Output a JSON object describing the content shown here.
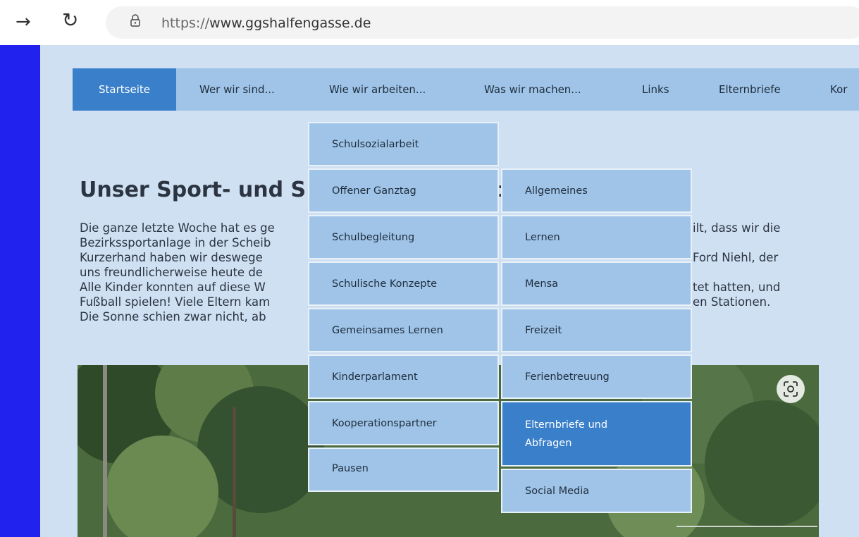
{
  "browser": {
    "url_prefix": "https://",
    "url_host": "www.ggshalfengasse.de",
    "forward_icon": "arrow-right-icon",
    "reload_icon": "reload-icon",
    "lock_icon": "lock-icon"
  },
  "colors": {
    "page_bg": "#cfe0f3",
    "nav_bg": "#9fc4e8",
    "nav_active": "#3a7fc9",
    "left_stripe": "#2222ee"
  },
  "topnav": {
    "items": [
      {
        "label": "Startseite"
      },
      {
        "label": "Wer wir sind..."
      },
      {
        "label": "Wie wir arbeiten..."
      },
      {
        "label": "Was wir machen..."
      },
      {
        "label": "Links"
      },
      {
        "label": "Elternbriefe"
      },
      {
        "label": "Kor"
      }
    ]
  },
  "submenu1": {
    "items": [
      {
        "label": "Schulsozialarbeit"
      },
      {
        "label": "Offener Ganztag"
      },
      {
        "label": "Schulbegleitung"
      },
      {
        "label": "Schulische Konzepte"
      },
      {
        "label": "Gemeinsames Lernen"
      },
      {
        "label": "Kinderparlament"
      },
      {
        "label": "Kooperationspartner"
      },
      {
        "label": "Pausen"
      }
    ]
  },
  "submenu2": {
    "items": [
      {
        "label": "Allgemeines"
      },
      {
        "label": "Lernen"
      },
      {
        "label": "Mensa"
      },
      {
        "label": "Freizeit"
      },
      {
        "label": "Ferienbetreuung"
      },
      {
        "label": "Elternbriefe und"
      },
      {
        "label": "Abfragen"
      },
      {
        "label": "Social Media"
      }
    ]
  },
  "article": {
    "headline_left": "Unser Sport- und S",
    "headline_right": ":",
    "lines_left": [
      "Die ganze letzte Woche hat es ge",
      "Bezirkssportanlage in der Scheib",
      "Kurzerhand haben wir deswege",
      "uns freundlicherweise heute de",
      "Alle Kinder konnten auf diese W",
      "Fußball spielen! Viele Eltern kam",
      "Die Sonne schien zwar nicht, ab"
    ],
    "lines_right": [
      "ilt, dass wir die",
      "",
      "Ford Niehl, der",
      "",
      "tet hatten, und",
      "en Stationen.",
      ""
    ],
    "lens_icon": "visual-search-icon"
  }
}
